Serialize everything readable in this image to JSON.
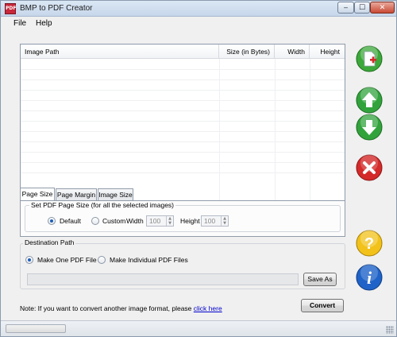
{
  "window": {
    "title": "BMP to PDF Creator",
    "icon_text": "PDF",
    "controls": {
      "minimize": "‒",
      "maximize": "☐",
      "close": "✕"
    }
  },
  "menu": {
    "items": [
      "File",
      "Help"
    ]
  },
  "file_list": {
    "columns": [
      "Image Path",
      "Size (in Bytes)",
      "Width",
      "Height"
    ],
    "rows": []
  },
  "side_buttons": [
    {
      "name": "add-file-icon",
      "color": "#3ca83a"
    },
    {
      "name": "move-up-icon",
      "color": "#32a33c"
    },
    {
      "name": "move-down-icon",
      "color": "#32a33c"
    },
    {
      "name": "remove-icon",
      "color": "#d42a2a"
    },
    {
      "name": "help-icon",
      "color": "#f2c21a"
    },
    {
      "name": "info-icon",
      "color": "#1f63c8"
    }
  ],
  "tabs": [
    "Page Size",
    "Page Margin",
    "Image Size"
  ],
  "page_size": {
    "group_label": "Set PDF Page Size (for all the selected images)",
    "default_label": "Default",
    "custom_label": "Custom",
    "width_label": "Width",
    "width_value": "100",
    "height_label": "Height",
    "height_value": "100",
    "selected": "Default"
  },
  "destination": {
    "group_label": "Destination Path",
    "option_one": "Make One PDF File",
    "option_individual": "Make Individual PDF Files",
    "selected": "Make One PDF File",
    "path_value": "",
    "save_as_label": "Save As"
  },
  "note": {
    "text": "Note: If you want to convert another image format, please",
    "link_text": "click here"
  },
  "convert_label": "Convert"
}
